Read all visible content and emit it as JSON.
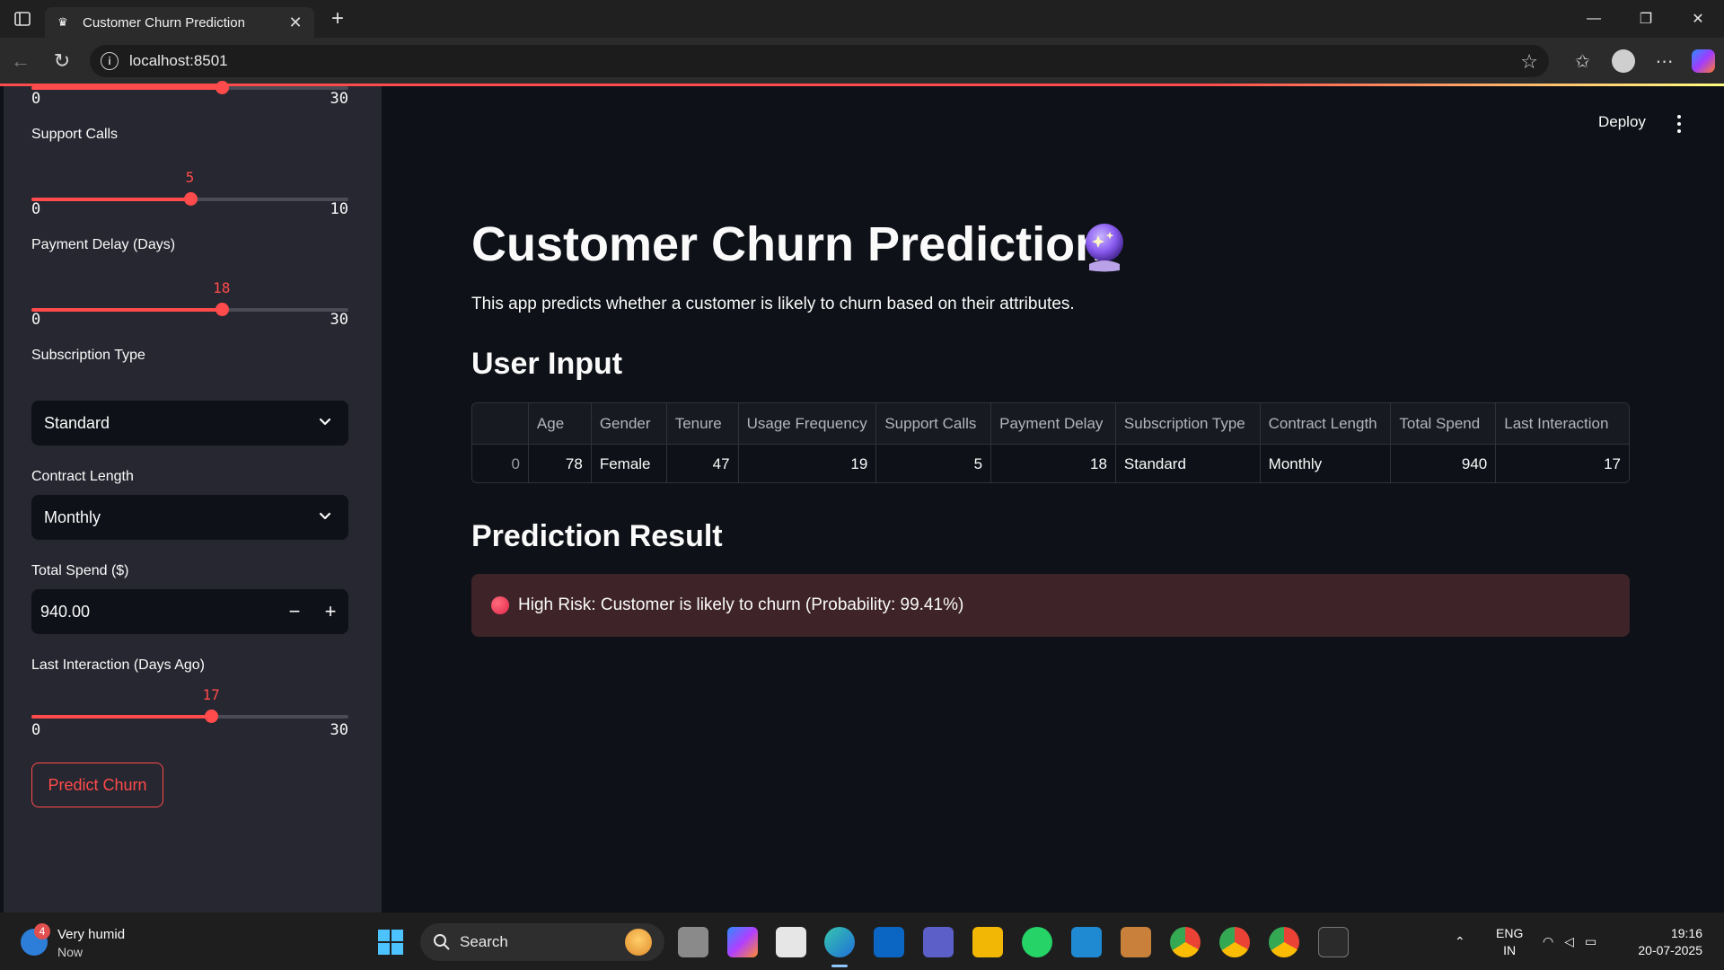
{
  "browser": {
    "tab_title": "Customer Churn Prediction",
    "url": "localhost:8501"
  },
  "sidebar": {
    "top_slider": {
      "value": 18,
      "min": "0",
      "max": "30",
      "fraction": 0.6
    },
    "support_calls": {
      "label": "Support Calls",
      "value": "5",
      "min": "0",
      "max": "10",
      "fraction": 0.5
    },
    "payment_delay": {
      "label": "Payment Delay (Days)",
      "value": "18",
      "min": "0",
      "max": "30",
      "fraction": 0.6
    },
    "subscription_type": {
      "label": "Subscription Type",
      "selected": "Standard"
    },
    "contract_length": {
      "label": "Contract Length",
      "selected": "Monthly"
    },
    "total_spend": {
      "label": "Total Spend ($)",
      "value": "940.00",
      "minus": "−",
      "plus": "+"
    },
    "last_interaction": {
      "label": "Last Interaction (Days Ago)",
      "value": "17",
      "min": "0",
      "max": "30",
      "fraction": 0.5667
    },
    "predict_button": "Predict Churn"
  },
  "header": {
    "deploy": "Deploy"
  },
  "main": {
    "title": "Customer Churn Prediction",
    "title_icon": "crystal-ball-icon",
    "description": "This app predicts whether a customer is likely to churn based on their attributes.",
    "user_input_heading": "User Input",
    "prediction_heading": "Prediction Result",
    "table": {
      "columns": [
        "",
        "Age",
        "Gender",
        "Tenure",
        "Usage Frequency",
        "Support Calls",
        "Payment Delay",
        "Subscription Type",
        "Contract Length",
        "Total Spend",
        "Last Interaction"
      ],
      "rows": [
        [
          "0",
          "78",
          "Female",
          "47",
          "19",
          "5",
          "18",
          "Standard",
          "Monthly",
          "940",
          "17"
        ]
      ]
    },
    "result": {
      "icon": "red-circle-icon",
      "text": "High Risk: Customer is likely to churn (Probability: 99.41%)"
    }
  },
  "taskbar": {
    "weather_line1": "Very humid",
    "weather_line2": "Now",
    "weather_badge": "4",
    "search_placeholder": "Search",
    "lang_line1": "ENG",
    "lang_line2": "IN",
    "time": "19:16",
    "date": "20-07-2025"
  },
  "colors": {
    "accent": "#ff4b4b",
    "sidebar_bg": "#262730",
    "main_bg": "#0e1117",
    "alert_bg": "#3e2429"
  }
}
